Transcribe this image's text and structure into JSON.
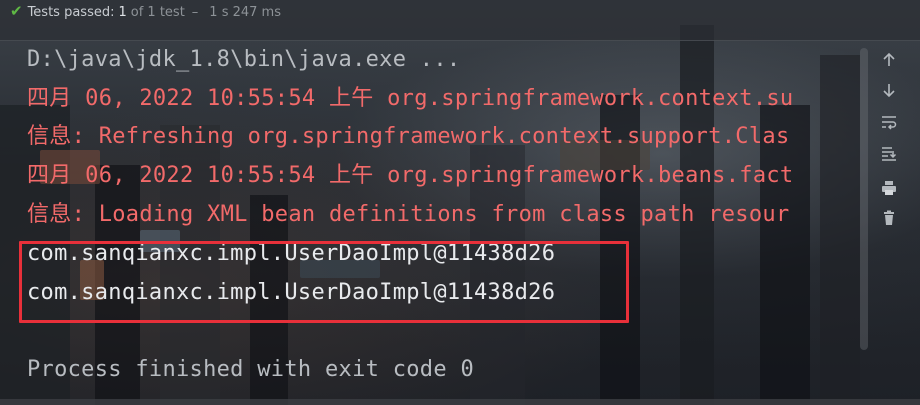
{
  "status": {
    "tests_passed_label": "Tests passed:",
    "passed_count": "1",
    "of_total": "of 1 test",
    "separator": "–",
    "duration": "1 s 247 ms"
  },
  "console": {
    "lines": [
      "D:\\java\\jdk_1.8\\bin\\java.exe ...",
      "四月 06, 2022 10:55:54 上午 org.springframework.context.su",
      "信息: Refreshing org.springframework.context.support.Clas",
      "四月 06, 2022 10:55:54 上午 org.springframework.beans.fact",
      "信息: Loading XML bean definitions from class path resour",
      "com.sanqianxc.impl.UserDaoImpl@11438d26",
      "com.sanqianxc.impl.UserDaoImpl@11438d26",
      "",
      "Process finished with exit code 0"
    ]
  },
  "colors": {
    "command": "#b8bcc1",
    "log_red": "#f26a6a",
    "output": "#e8eaed",
    "highlight": "#e8303a",
    "pass_green": "#5fb845"
  },
  "toolbar": {
    "icons": [
      "arrow-up-icon",
      "arrow-down-icon",
      "soft-wrap-icon",
      "scroll-to-end-icon",
      "print-icon",
      "trash-icon"
    ]
  }
}
